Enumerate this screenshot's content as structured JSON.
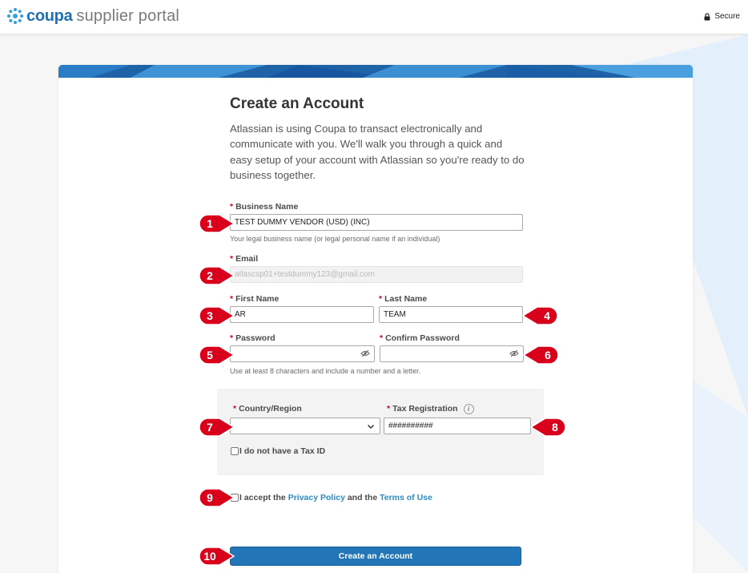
{
  "header": {
    "logo_brand": "coupa",
    "logo_rest": "supplier portal",
    "secure_label": "Secure"
  },
  "form": {
    "title": "Create an Account",
    "intro": "Atlassian is using Coupa to transact electronically and communicate with you. We'll walk you through a quick and easy setup of your account with Atlassian so you're ready to do business together.",
    "required_mark": "*",
    "business_name": {
      "label": "Business Name",
      "value": "TEST DUMMY VENDOR (USD) (INC)",
      "hint": "Your legal business name (or legal personal name if an individual)"
    },
    "email": {
      "label": "Email",
      "value": "atlascsp01+testdummy123@gmail.com"
    },
    "first_name": {
      "label": "First Name",
      "value": "AR"
    },
    "last_name": {
      "label": "Last Name",
      "value": "TEAM"
    },
    "password": {
      "label": "Password",
      "value": ""
    },
    "confirm_password": {
      "label": "Confirm Password",
      "value": ""
    },
    "password_hint": "Use at least 8 characters and include a number and a letter.",
    "country": {
      "label": "Country/Region",
      "value": ""
    },
    "tax_registration": {
      "label": "Tax Registration",
      "value": "##########"
    },
    "no_tax_id_label": "I do not have a Tax ID",
    "accept": {
      "prefix": "I accept the ",
      "privacy_link": "Privacy Policy",
      "middle": " and the ",
      "terms_link": "Terms of Use"
    },
    "submit_label": "Create an Account"
  },
  "markers": [
    "1",
    "2",
    "3",
    "4",
    "5",
    "6",
    "7",
    "8",
    "9",
    "10"
  ],
  "colors": {
    "brand_blue": "#1f6fb2",
    "button_blue": "#2276b8",
    "link_blue": "#2c8ac8",
    "required_red": "#d0021b",
    "marker_red": "#d9001b"
  },
  "icons": {
    "logo": "coupa-logo-icon",
    "lock": "lock-icon",
    "eye": "eye-slash-icon",
    "chevron": "chevron-down-icon",
    "info": "info-icon"
  }
}
